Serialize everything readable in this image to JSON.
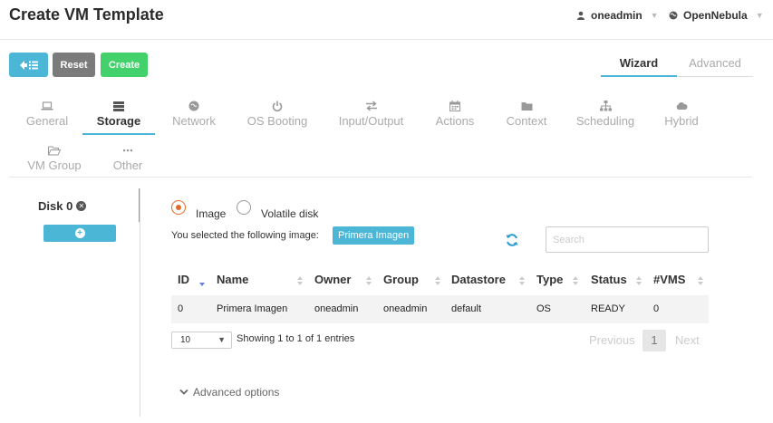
{
  "header": {
    "title": "Create VM Template",
    "user": "oneadmin",
    "zone": "OpenNebula"
  },
  "toolbar": {
    "reset_label": "Reset",
    "create_label": "Create"
  },
  "mode_tabs": [
    "Wizard",
    "Advanced"
  ],
  "section_tabs": [
    {
      "label": "General",
      "icon": "laptop-icon"
    },
    {
      "label": "Storage",
      "icon": "server-icon",
      "active": true
    },
    {
      "label": "Network",
      "icon": "globe-icon"
    },
    {
      "label": "OS Booting",
      "icon": "power-icon"
    },
    {
      "label": "Input/Output",
      "icon": "exchange-icon"
    },
    {
      "label": "Actions",
      "icon": "calendar-icon"
    },
    {
      "label": "Context",
      "icon": "folder-icon"
    },
    {
      "label": "Scheduling",
      "icon": "sitemap-icon"
    },
    {
      "label": "Hybrid",
      "icon": "cloud-icon"
    },
    {
      "label": "VM Group",
      "icon": "folder-open-icon"
    },
    {
      "label": "Other",
      "icon": "ellipsis-icon"
    }
  ],
  "disk": {
    "label": "Disk 0"
  },
  "source": {
    "image_label": "Image",
    "volatile_label": "Volatile disk",
    "selected_text": "You selected the following image:",
    "selected_image": "Primera Imagen"
  },
  "search": {
    "placeholder": "Search"
  },
  "table": {
    "columns": [
      "ID",
      "Name",
      "Owner",
      "Group",
      "Datastore",
      "Type",
      "Status",
      "#VMS"
    ],
    "rows": [
      [
        "0",
        "Primera Imagen",
        "oneadmin",
        "oneadmin",
        "default",
        "OS",
        "READY",
        "0"
      ]
    ]
  },
  "pagination": {
    "length": "10",
    "info": "Showing 1 to 1 of 1 entries",
    "previous": "Previous",
    "current": "1",
    "next": "Next"
  },
  "advanced_options": "Advanced options",
  "colors": {
    "accent": "#4bb6d6",
    "reset": "#7b7b7b",
    "create": "#43d16c",
    "radio_selected": "#e06a2c"
  }
}
